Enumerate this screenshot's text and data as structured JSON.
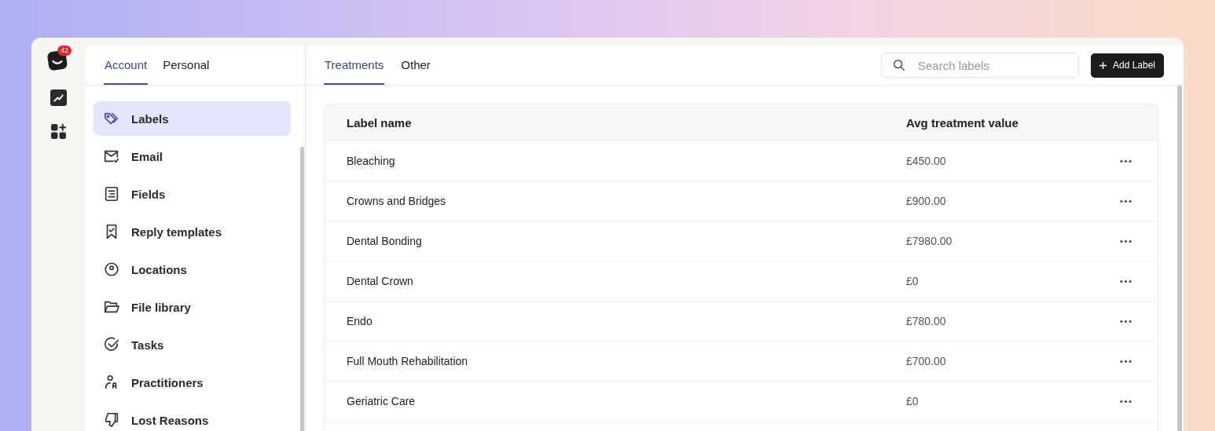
{
  "rail": {
    "badge": "42",
    "items": [
      {
        "kind": "chart"
      },
      {
        "kind": "apps"
      }
    ]
  },
  "sidebar": {
    "tabs": [
      {
        "label": "Account",
        "selected": true
      },
      {
        "label": "Personal",
        "selected": false
      }
    ],
    "items": [
      {
        "label": "Labels",
        "selected": true
      },
      {
        "label": "Email",
        "selected": false
      },
      {
        "label": "Fields",
        "selected": false
      },
      {
        "label": "Reply templates",
        "selected": false
      },
      {
        "label": "Locations",
        "selected": false
      },
      {
        "label": "File library",
        "selected": false
      },
      {
        "label": "Tasks",
        "selected": false
      },
      {
        "label": "Practitioners",
        "selected": false
      },
      {
        "label": "Lost Reasons",
        "selected": false
      }
    ]
  },
  "main": {
    "tabs": [
      {
        "label": "Treatments",
        "selected": true
      },
      {
        "label": "Other",
        "selected": false
      }
    ],
    "search": {
      "placeholder": "Search labels"
    },
    "add_button": {
      "label": "Add Label"
    },
    "table": {
      "columns": [
        "Label name",
        "Avg treatment value"
      ],
      "rows": [
        {
          "name": "Bleaching",
          "value": "£450.00"
        },
        {
          "name": "Crowns and Bridges",
          "value": "£900.00"
        },
        {
          "name": "Dental Bonding",
          "value": "£7980.00"
        },
        {
          "name": "Dental Crown",
          "value": "£0"
        },
        {
          "name": "Endo",
          "value": "£780.00"
        },
        {
          "name": "Full Mouth Rehabilitation",
          "value": "£700.00"
        },
        {
          "name": "Geriatric Care",
          "value": "£0"
        }
      ]
    }
  }
}
